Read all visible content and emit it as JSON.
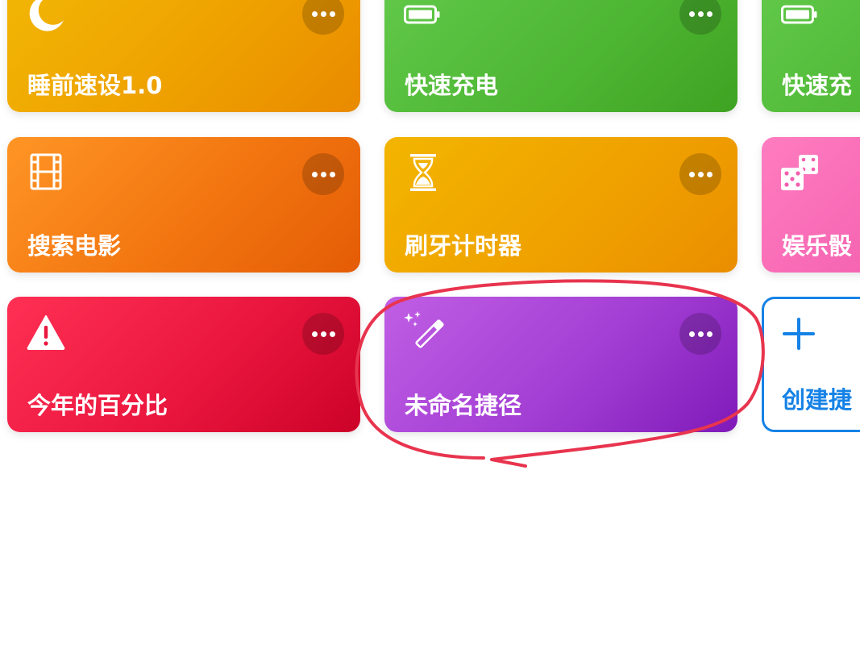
{
  "shortcuts": [
    {
      "label": "睡前速设1.0",
      "icon": "moon-icon",
      "color": "#f0a700"
    },
    {
      "label": "快速充电",
      "icon": "battery-icon",
      "color": "#4cb532"
    },
    {
      "label": "快速充",
      "icon": "battery-icon",
      "color": "#4cb532"
    },
    {
      "label": "搜索电影",
      "icon": "film-icon",
      "color": "#f27510"
    },
    {
      "label": "刷牙计时器",
      "icon": "hourglass-icon",
      "color": "#efa000"
    },
    {
      "label": "娱乐骰",
      "icon": "dice-icon",
      "color": "#f35fae"
    },
    {
      "label": "今年的百分比",
      "icon": "warning-icon",
      "color": "#ea163e"
    },
    {
      "label": "未命名捷径",
      "icon": "magic-wand-icon",
      "color": "#a33ed4"
    }
  ],
  "create": {
    "label": "创建捷",
    "icon": "plus-icon",
    "color": "#1682e6"
  },
  "annotation": {
    "color": "#e8344e",
    "target": "未命名捷径"
  }
}
